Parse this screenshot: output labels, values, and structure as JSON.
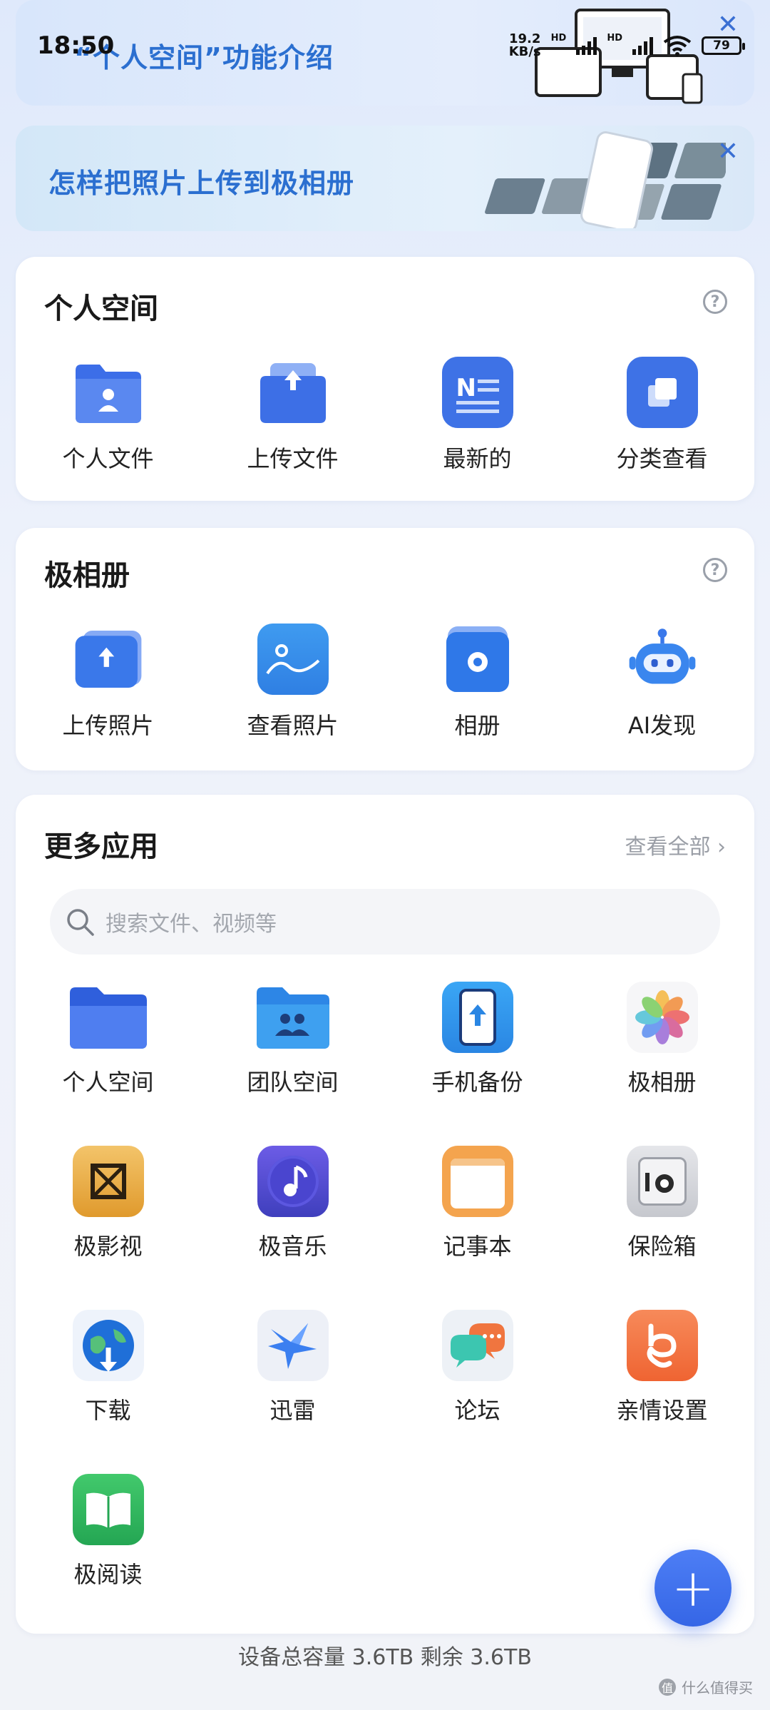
{
  "status": {
    "time": "18:50",
    "net_speed_value": "19.2",
    "net_speed_unit": "KB/s",
    "hd1": "HD",
    "hd2": "HD",
    "battery": "79"
  },
  "banners": [
    {
      "title": "“个人空间”功能介绍",
      "close": "✕"
    },
    {
      "title": "怎样把照片上传到极相册",
      "close": "✕"
    }
  ],
  "personal_space": {
    "title": "个人空间",
    "help": "?",
    "items": [
      {
        "label": "个人文件",
        "icon": "personal-files-icon"
      },
      {
        "label": "上传文件",
        "icon": "upload-file-icon"
      },
      {
        "label": "最新的",
        "icon": "recent-icon"
      },
      {
        "label": "分类查看",
        "icon": "category-icon"
      }
    ]
  },
  "album": {
    "title": "极相册",
    "help": "?",
    "items": [
      {
        "label": "上传照片",
        "icon": "upload-photo-icon"
      },
      {
        "label": "查看照片",
        "icon": "view-photo-icon"
      },
      {
        "label": "相册",
        "icon": "album-icon"
      },
      {
        "label": "AI发现",
        "icon": "ai-robot-icon"
      }
    ]
  },
  "more_apps": {
    "title": "更多应用",
    "see_all": "查看全部 ›",
    "search_placeholder": "搜索文件、视频等",
    "apps": [
      {
        "label": "个人空间",
        "icon": "folder-icon"
      },
      {
        "label": "团队空间",
        "icon": "team-folder-icon"
      },
      {
        "label": "手机备份",
        "icon": "phone-backup-icon"
      },
      {
        "label": "极相册",
        "icon": "photos-flower-icon"
      },
      {
        "label": "极影视",
        "icon": "video-icon"
      },
      {
        "label": "极音乐",
        "icon": "music-icon"
      },
      {
        "label": "记事本",
        "icon": "notepad-icon"
      },
      {
        "label": "保险箱",
        "icon": "safe-icon"
      },
      {
        "label": "下载",
        "icon": "download-globe-icon"
      },
      {
        "label": "迅雷",
        "icon": "thunder-bird-icon"
      },
      {
        "label": "论坛",
        "icon": "forum-chat-icon"
      },
      {
        "label": "亲情设置",
        "icon": "family-icon"
      },
      {
        "label": "极阅读",
        "icon": "reader-book-icon"
      }
    ]
  },
  "fab": {
    "symbol": "+"
  },
  "footer": {
    "capacity": "设备总容量 3.6TB  剩余 3.6TB"
  },
  "watermark": {
    "text": "什么值得买",
    "glyph": "值"
  },
  "colors": {
    "accent": "#3566e6",
    "banner_text": "#2b6fd0"
  }
}
